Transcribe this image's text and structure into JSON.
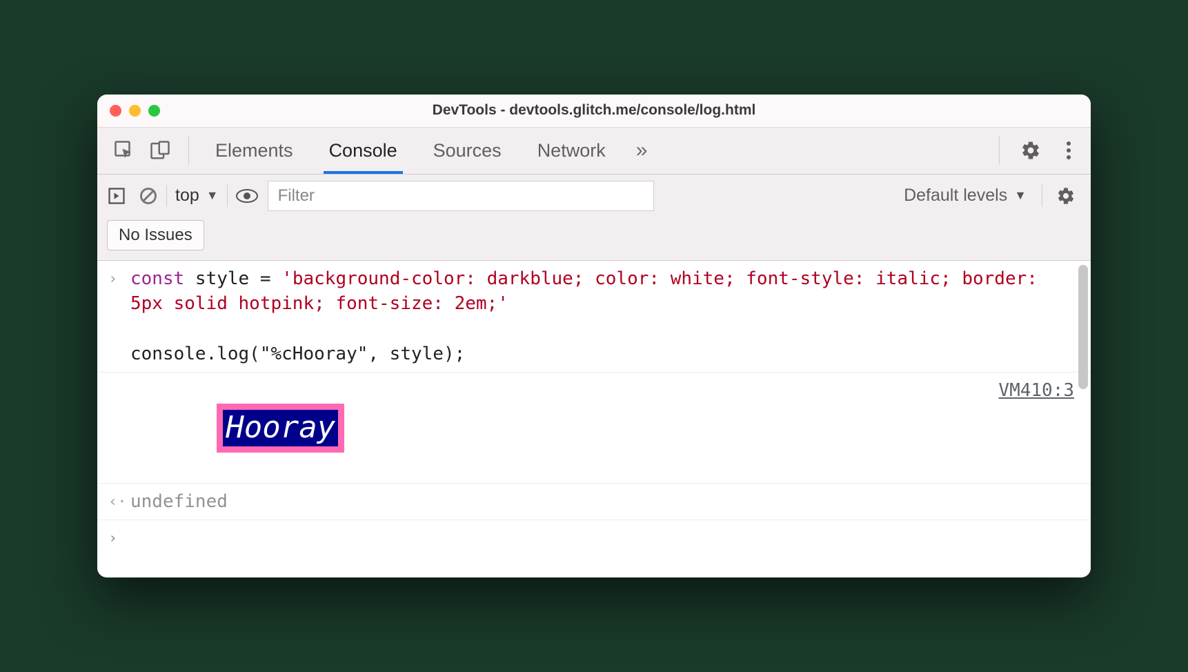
{
  "window": {
    "title": "DevTools - devtools.glitch.me/console/log.html"
  },
  "tabs": {
    "elements": "Elements",
    "console": "Console",
    "sources": "Sources",
    "network": "Network"
  },
  "subbar": {
    "context": "top",
    "filter_placeholder": "Filter",
    "levels": "Default levels",
    "issues": "No Issues"
  },
  "console": {
    "code_kw": "const",
    "code_mid": " style = ",
    "code_str": "'background-color: darkblue; color: white; font-style: italic; border: 5px solid hotpink; font-size: 2em;'",
    "code_line2": "console.log(\"%cHooray\", style);",
    "styled_text": "Hooray",
    "source_link": "VM410:3",
    "return_value": "undefined"
  }
}
